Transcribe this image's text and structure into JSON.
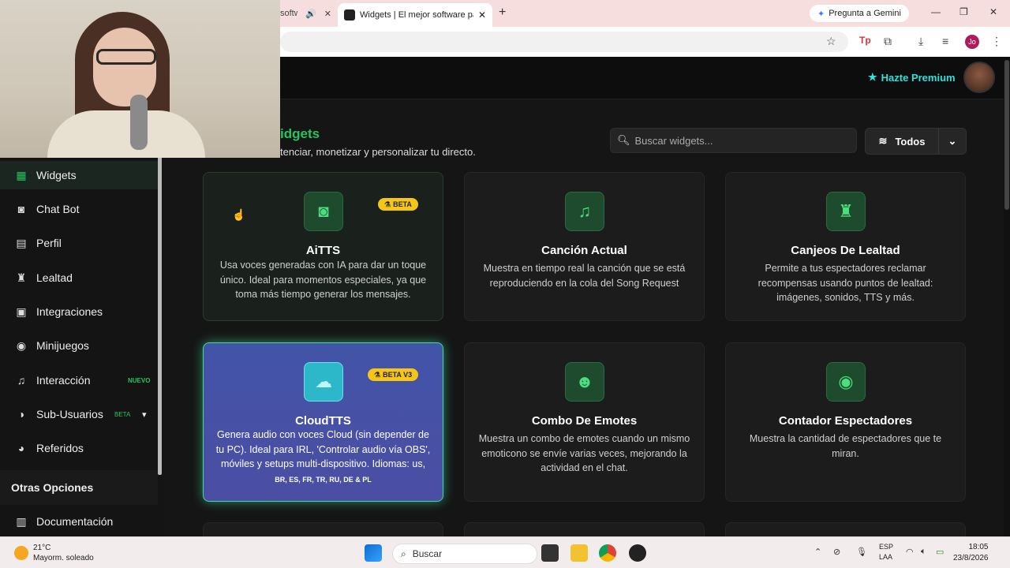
{
  "browser": {
    "prev_tab_title": "softw",
    "active_tab_title": "Widgets | El mejor software par",
    "gemini_label": "Pregunta a Gemini",
    "profile_initials": "Jo"
  },
  "header": {
    "premium_label": "Hazte Premium"
  },
  "page": {
    "title": "idgets",
    "subtitle": "tenciar, monetizar y personalizar tu directo.",
    "search_placeholder": "Buscar widgets...",
    "filter_label": "Todos"
  },
  "sidebar": {
    "items": [
      {
        "label": "Widgets",
        "icon": "grid-icon"
      },
      {
        "label": "Chat Bot",
        "icon": "robot-icon"
      },
      {
        "label": "Perfil",
        "icon": "id-card-icon"
      },
      {
        "label": "Lealtad",
        "icon": "trophy-icon"
      },
      {
        "label": "Integraciones",
        "icon": "puzzle-icon"
      },
      {
        "label": "Minijuegos",
        "icon": "gamepad-icon"
      },
      {
        "label": "Interacción",
        "icon": "music-icon",
        "badge": "NUEVO"
      },
      {
        "label": "Sub-Usuarios",
        "icon": "users-icon",
        "badge": "BETA"
      },
      {
        "label": "Referidos",
        "icon": "user-plus-icon"
      }
    ],
    "section_title": "Otras Opciones",
    "extra_item": "Documentación"
  },
  "cards": [
    {
      "title": "AiTTS",
      "desc": "Usa voces generadas con IA para dar un toque único. Ideal para momentos especiales, ya que toma más tiempo generar los mensajes.",
      "badge": "BETA",
      "icon": "robot-icon"
    },
    {
      "title": "Canción Actual",
      "desc": "Muestra en tiempo real la canción que se está reproduciendo en la cola del Song Request",
      "icon": "music-icon"
    },
    {
      "title": "Canjeos De Lealtad",
      "desc": "Permite a tus espectadores reclamar recompensas usando puntos de lealtad: imágenes, sonidos, TTS y más.",
      "icon": "trophy-icon"
    },
    {
      "title": "CloudTTS",
      "desc": "Genera audio con voces Cloud (sin depender de tu PC). Ideal para IRL, 'Controlar audio vía OBS', móviles y setups multi-dispositivo. Idiomas: us,",
      "desc_small": "BR, ES, FR, TR, RU, DE & PL",
      "badge": "BETA V3",
      "icon": "cloud-icon"
    },
    {
      "title": "Combo De Emotes",
      "desc": "Muestra un combo de emotes cuando un mismo emoticono se envíe varias veces, mejorando la actividad en el chat.",
      "icon": "smile-icon"
    },
    {
      "title": "Contador Espectadores",
      "desc": "Muestra la cantidad de espectadores que te miran.",
      "icon": "eye-icon"
    }
  ],
  "taskbar": {
    "temperature": "21°C",
    "weather": "Mayorm. soleado",
    "search_label": "Buscar",
    "lang1": "ESP",
    "lang2": "LAA",
    "time": "18:05",
    "date": "23/8/2026"
  },
  "colors": {
    "accent_green": "#22c55e",
    "premium_cyan": "#2fe1d8",
    "beta_yellow": "#f5c518"
  }
}
